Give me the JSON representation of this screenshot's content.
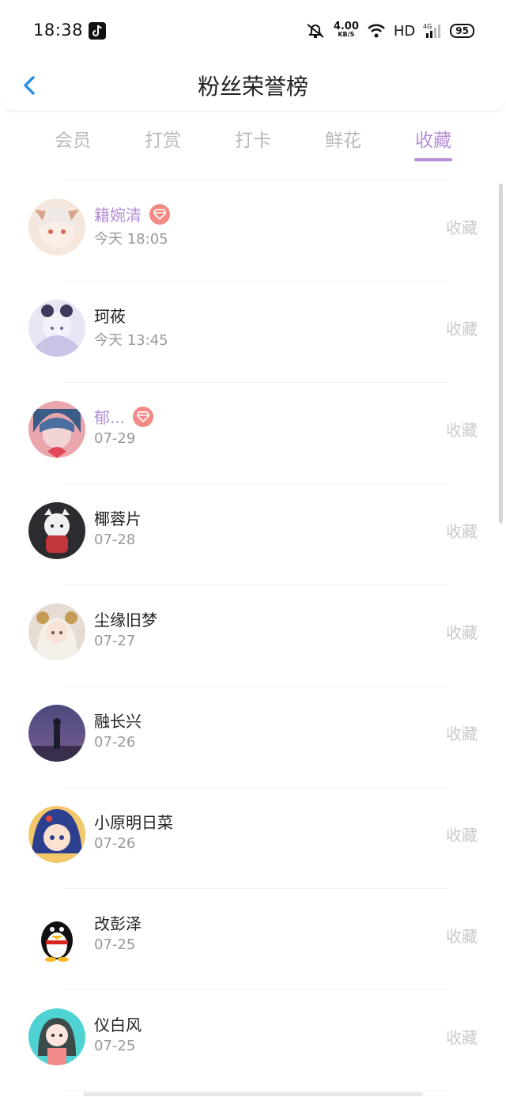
{
  "status": {
    "time": "18:38",
    "net_speed": "4.00",
    "net_unit": "KB/S",
    "hd": "HD",
    "network": "4G",
    "battery": "95"
  },
  "header": {
    "title": "粉丝荣誉榜"
  },
  "tabs": [
    "会员",
    "打赏",
    "打卡",
    "鲜花",
    "收藏"
  ],
  "active_tab": "收藏",
  "colors": {
    "accent": "#b48fd6",
    "badge": "#f38a86"
  },
  "list": [
    {
      "name": "籍婉清",
      "date": "今天 18:05",
      "action": "收藏",
      "vip": true
    },
    {
      "name": "珂莜",
      "date": "今天 13:45",
      "action": "收藏",
      "vip": false
    },
    {
      "name": "郁...",
      "date": "07-29",
      "action": "收藏",
      "vip": true
    },
    {
      "name": "椰蓉片",
      "date": "07-28",
      "action": "收藏",
      "vip": false
    },
    {
      "name": "尘缘旧梦",
      "date": "07-27",
      "action": "收藏",
      "vip": false
    },
    {
      "name": "融长兴",
      "date": "07-26",
      "action": "收藏",
      "vip": false
    },
    {
      "name": "小原明日菜",
      "date": "07-26",
      "action": "收藏",
      "vip": false
    },
    {
      "name": "改彭泽",
      "date": "07-25",
      "action": "收藏",
      "vip": false
    },
    {
      "name": "仪白风",
      "date": "07-25",
      "action": "收藏",
      "vip": false
    }
  ]
}
